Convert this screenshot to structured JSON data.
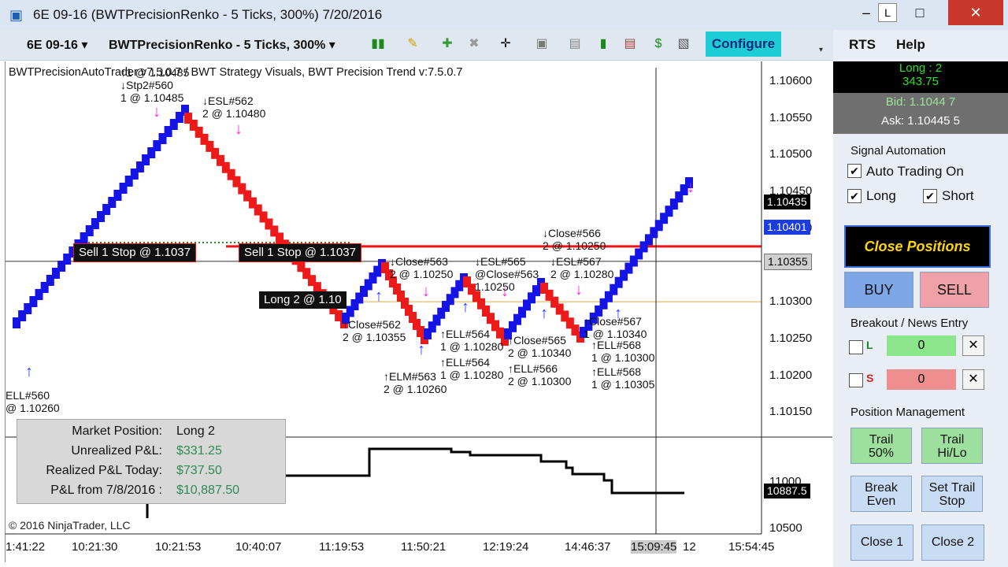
{
  "window": {
    "title": "6E 09-16 (BWTPrecisionRenko - 5 Ticks, 300%)  7/20/2016",
    "minimize_label": "–",
    "mini_label": "L",
    "maximize_label": "□",
    "close_label": "✕"
  },
  "toolbar": {
    "instrument": "6E 09-16",
    "bar_type": "BWTPrecisionRenko - 5 Ticks, 300%",
    "configure_label": "Configure",
    "overflow_label": "▾"
  },
  "chart": {
    "indicator_text": "BWTPrecisionAutoTrader v7.5.0.7 / BWT Strategy Visuals, BWT Precision Trend v:7.5.0.7",
    "price_ticks": [
      {
        "label": "1.10600",
        "value": 1.106
      },
      {
        "label": "1.10550",
        "value": 1.1055
      },
      {
        "label": "1.10500",
        "value": 1.105
      },
      {
        "label": "1.10450",
        "value": 1.1045
      },
      {
        "label": "1.10400",
        "value": 1.104
      },
      {
        "label": "1.10350",
        "value": 1.1035
      },
      {
        "label": "1.10300",
        "value": 1.103
      },
      {
        "label": "1.10250",
        "value": 1.1025
      },
      {
        "label": "1.10200",
        "value": 1.102
      },
      {
        "label": "1.10150",
        "value": 1.1015
      }
    ],
    "price_markers": [
      {
        "label": "1.10435",
        "value": 1.10435,
        "style": "black"
      },
      {
        "label": "1.10401",
        "value": 1.10401,
        "style": "blue"
      },
      {
        "label": "1.10355",
        "value": 1.10355,
        "style": "gray"
      }
    ],
    "pnl_ticks": [
      {
        "label": "11000"
      },
      {
        "label": "10500"
      }
    ],
    "pnl_marker": "10887.5",
    "time_labels": [
      "1:41:22",
      "10:21:30",
      "10:21:53",
      "10:40:07",
      "11:19:53",
      "11:50:21",
      "12:19:24",
      "14:46:37",
      "15:09:45",
      "12",
      "15:54:45"
    ],
    "order_labels": [
      {
        "text": "Sell 1 Stop @ 1.1037"
      },
      {
        "text": "Sell 1 Stop @ 1.1037"
      },
      {
        "text": "Long 2 @ 1.10"
      }
    ],
    "signals": [
      {
        "text": "↑1 @ 1.10485\n↓Stp2#560\n1 @ 1.10485"
      },
      {
        "text": "↓ESL#562\n2 @ 1.10480"
      },
      {
        "text": "↓Close#566\n2 @ 1.10250"
      },
      {
        "text": "↓Close#563\n2 @ 1.10250"
      },
      {
        "text": "↓ESL#565\n@Close#563\n1.10250"
      },
      {
        "text": "↓ESL#567\n2 @ 1.10280"
      },
      {
        "text": "↑Close#562\n2 @ 1.10355"
      },
      {
        "text": "↑ELL#564\n1 @ 1.10280"
      },
      {
        "text": "↑ELL#564\n1 @ 1.10280"
      },
      {
        "text": "↑ELM#563\n2 @ 1.10260"
      },
      {
        "text": "↑Close#565\n2 @ 1.10340"
      },
      {
        "text": "↑ELL#566\n2 @ 1.10300"
      },
      {
        "text": "↑Close#567\n1 @ 1.10340"
      },
      {
        "text": "↑ELL#568\n1 @ 1.10300"
      },
      {
        "text": "↑ELL#568\n1 @ 1.10305"
      },
      {
        "text": "ELL#560\n@ 1.10260"
      }
    ],
    "colors": {
      "up_brick": "#1414e6",
      "down_brick": "#ee1a1a",
      "arrow_up": "#2a3cff",
      "arrow_down": "#ff22d6"
    },
    "copyright": "© 2016 NinjaTrader, LLC"
  },
  "pnl_panel": {
    "rows": [
      {
        "key": "Market Position:",
        "value": "Long 2"
      },
      {
        "key": "Unrealized P&L:",
        "value": "$331.25"
      },
      {
        "key": "Realized P&L Today:",
        "value": "$737.50"
      },
      {
        "key": "P&L from 7/8/2016 :",
        "value": "$10,887.50"
      }
    ]
  },
  "side": {
    "menu_rts": "RTS",
    "menu_help": "Help",
    "position_line1": "Long : 2",
    "position_line2": "343.75",
    "bid": "Bid: 1.1044 7",
    "ask": "Ask: 1.10445 5",
    "signal_automation_title": "Signal Automation",
    "auto_trading_label": "Auto Trading On",
    "long_label": "Long",
    "short_label": "Short",
    "close_positions_label": "Close Positions",
    "buy_label": "BUY",
    "sell_label": "SELL",
    "breakout_title": "Breakout / News Entry",
    "l_label": "L",
    "s_label": "S",
    "l_value": "0",
    "s_value": "0",
    "x_label": "✕",
    "position_mgmt_title": "Position Management",
    "trail50_label": "Trail\n50%",
    "trailhilo_label": "Trail\nHi/Lo",
    "breakeven_label": "Break\nEven",
    "settrail_label": "Set Trail\nStop",
    "close1_label": "Close 1",
    "close2_label": "Close 2"
  }
}
